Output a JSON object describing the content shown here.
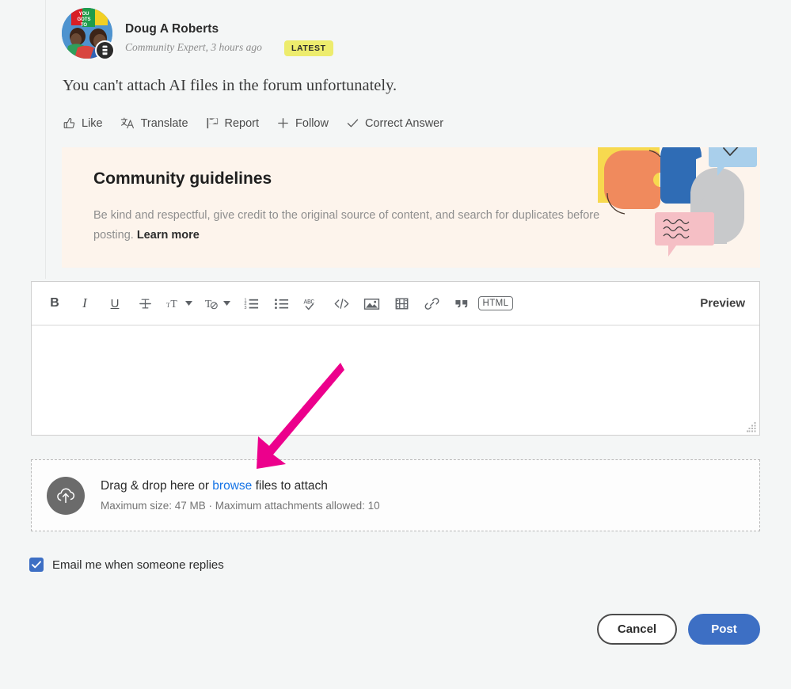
{
  "post": {
    "author_name": "Doug A Roberts",
    "author_meta": "Community Expert, 3 hours ago",
    "badge": "LATEST",
    "body": "You can't attach AI files in the forum unfortunately.",
    "actions": [
      {
        "label": "Like",
        "icon": "thumbs-up-icon"
      },
      {
        "label": "Translate",
        "icon": "translate-icon"
      },
      {
        "label": "Report",
        "icon": "flag-icon"
      },
      {
        "label": "Follow",
        "icon": "plus-icon"
      },
      {
        "label": "Correct Answer",
        "icon": "check-icon"
      }
    ]
  },
  "guidelines": {
    "title": "Community guidelines",
    "text": "Be kind and respectful, give credit to the original source of content, and search for duplicates before posting. ",
    "link": "Learn more",
    "bg_color": "#fdf4ec"
  },
  "editor": {
    "preview_label": "Preview",
    "html_label": "HTML",
    "body_value": "",
    "body_placeholder": "",
    "toolbar": [
      {
        "name": "bold-button",
        "label": "B",
        "kind": "text-bold"
      },
      {
        "name": "italic-button",
        "label": "I",
        "kind": "text-italic"
      },
      {
        "name": "underline-button",
        "label": "U",
        "kind": "text-underline"
      },
      {
        "name": "strikethrough-button",
        "label": "T",
        "kind": "icon"
      },
      {
        "name": "font-size-button",
        "label": "TT",
        "kind": "icon-caret"
      },
      {
        "name": "text-color-button",
        "label": "T",
        "kind": "icon-caret"
      },
      {
        "name": "ordered-list-button",
        "label": "",
        "kind": "icon"
      },
      {
        "name": "unordered-list-button",
        "label": "",
        "kind": "icon"
      },
      {
        "name": "spellcheck-button",
        "label": "ABC",
        "kind": "icon"
      },
      {
        "name": "code-button",
        "label": "</>",
        "kind": "icon"
      },
      {
        "name": "insert-image-button",
        "label": "",
        "kind": "icon"
      },
      {
        "name": "insert-video-button",
        "label": "",
        "kind": "icon"
      },
      {
        "name": "insert-link-button",
        "label": "",
        "kind": "icon"
      },
      {
        "name": "blockquote-button",
        "label": "",
        "kind": "icon"
      },
      {
        "name": "html-source-button",
        "label": "HTML",
        "kind": "boxed"
      }
    ]
  },
  "dropzone": {
    "title_before": "Drag & drop here or ",
    "browse": "browse",
    "title_after": " files to attach",
    "subtitle": "Maximum size: 47 MB · Maximum attachments allowed: 10"
  },
  "notify": {
    "label": "Email me when someone replies",
    "checked": true,
    "accent_color": "#3d6fc4"
  },
  "footer": {
    "cancel_label": "Cancel",
    "post_label": "Post",
    "post_color": "#3d6fc4"
  },
  "annotation": {
    "arrow_color": "#ec008c",
    "target": "browse"
  }
}
